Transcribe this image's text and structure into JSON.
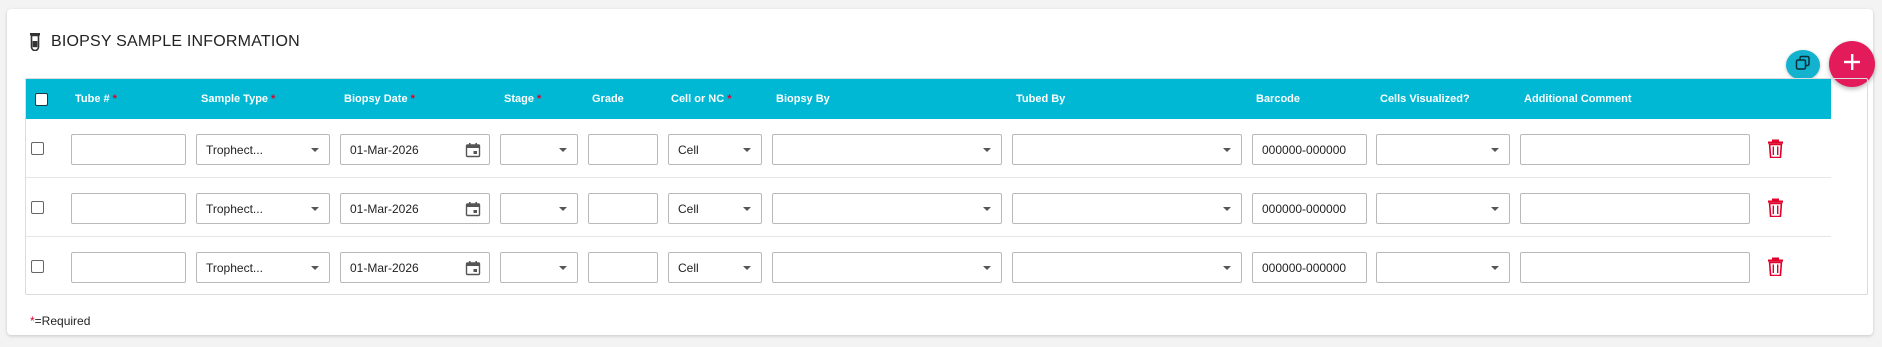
{
  "section": {
    "title": "BIOPSY SAMPLE INFORMATION",
    "icon": "test-tube-icon"
  },
  "actions": {
    "copy_icon": "copy-icon",
    "add_icon": "plus-icon",
    "add_symbol": "+"
  },
  "colors": {
    "header_bg": "#00b8d4",
    "add_button": "#e31b5a",
    "copy_button": "#13b2cf",
    "required": "#e0002a",
    "delete_icon": "#e0002a"
  },
  "table": {
    "columns": [
      {
        "label": "Tube #",
        "required": true
      },
      {
        "label": "Sample Type",
        "required": true
      },
      {
        "label": "Biopsy Date",
        "required": true
      },
      {
        "label": "Stage",
        "required": true
      },
      {
        "label": "Grade",
        "required": false
      },
      {
        "label": "Cell or NC",
        "required": true
      },
      {
        "label": "Biopsy By",
        "required": false
      },
      {
        "label": "Tubed By",
        "required": false
      },
      {
        "label": "Barcode",
        "required": false
      },
      {
        "label": "Cells Visualized?",
        "required": false
      },
      {
        "label": "Additional Comment",
        "required": false
      }
    ],
    "required_marker": "*",
    "rows": [
      {
        "tube": "",
        "sample_type": "Trophect...",
        "biopsy_date": "01-Mar-2026",
        "stage": "",
        "grade": "",
        "cell_or_nc": "Cell",
        "biopsy_by": "",
        "tubed_by": "",
        "barcode": "000000-000000",
        "cells_visualized": "",
        "comment": "",
        "checked": false
      },
      {
        "tube": "",
        "sample_type": "Trophect...",
        "biopsy_date": "01-Mar-2026",
        "stage": "",
        "grade": "",
        "cell_or_nc": "Cell",
        "biopsy_by": "",
        "tubed_by": "",
        "barcode": "000000-000000",
        "cells_visualized": "",
        "comment": "",
        "checked": false
      },
      {
        "tube": "",
        "sample_type": "Trophect...",
        "biopsy_date": "01-Mar-2026",
        "stage": "",
        "grade": "",
        "cell_or_nc": "Cell",
        "biopsy_by": "",
        "tubed_by": "",
        "barcode": "000000-000000",
        "cells_visualized": "",
        "comment": "",
        "checked": false
      }
    ]
  },
  "footer": {
    "required_marker": "*",
    "required_note": "=Required"
  }
}
